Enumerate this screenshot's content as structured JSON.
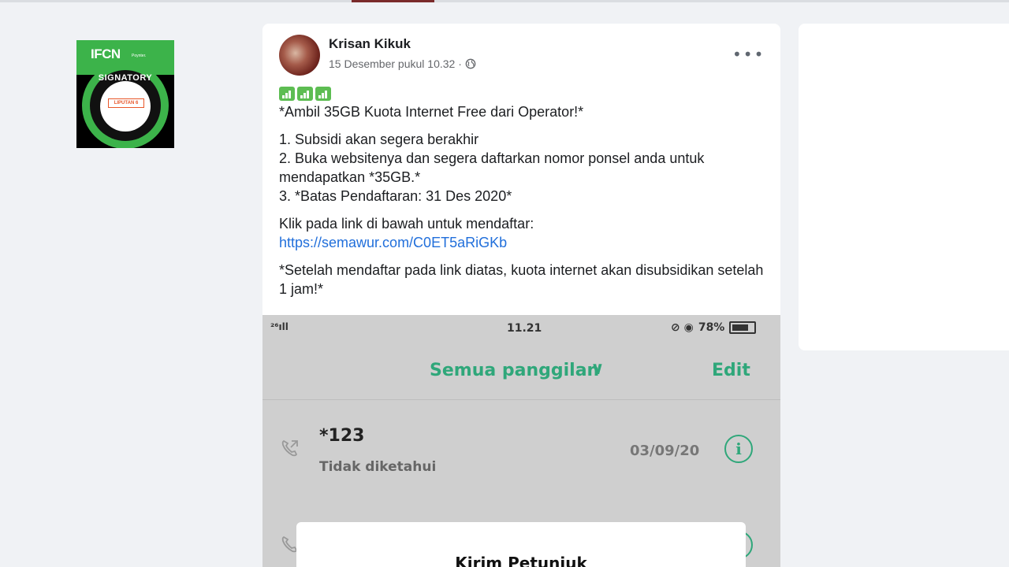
{
  "badge": {
    "brand": "IFCN",
    "sub": "Poynter.",
    "ring_text": "SIGNATORY",
    "logo_text": "LIPUTAN 6"
  },
  "post": {
    "author": "Krisan Kikuk",
    "timestamp": "15 Desember pukul 10.32 ·",
    "more_label": "•••",
    "lines": {
      "l1": "*Ambil 35GB Kuota Internet Free dari Operator!*",
      "l2": "1. Subsidi akan segera berakhir",
      "l3": "2. Buka websitenya dan segera daftarkan nomor ponsel anda untuk mendapatkan *35GB.*",
      "l4": "3. *Batas Pendaftaran: 31 Des 2020*",
      "l5": "Klik pada link di bawah untuk mendaftar:",
      "link": "https://semawur.com/C0ET5aRiGKb",
      "l6": "*Setelah mendaftar pada link diatas, kuota internet akan disubsidikan setelah 1 jam!*"
    }
  },
  "phone": {
    "signal": "²⁶ıll",
    "time": "11.21",
    "battery": "78%",
    "header_title": "Semua panggilan",
    "chevron": "∨",
    "edit_label": "Edit",
    "call": {
      "number": "*123",
      "status": "Tidak diketahui",
      "date": "03/09/20",
      "info": "i"
    },
    "dialog_title": "Kirim Petunjuk"
  },
  "colors": {
    "link": "#216fdb",
    "accent_green": "#2fa77a",
    "badge_green": "#3cb34a",
    "background": "#f0f2f5"
  },
  "icons": [
    "globe-icon",
    "more-icon",
    "signal-bar-emoji",
    "phone-call-icon",
    "info-icon",
    "battery-icon"
  ]
}
